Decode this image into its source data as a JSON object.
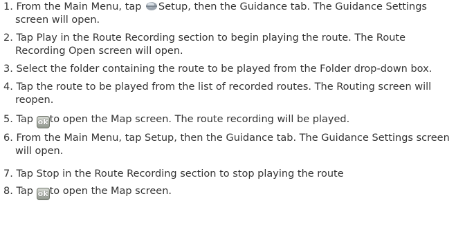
{
  "steps": [
    {
      "num": "1.",
      "before": "From the Main Menu, tap",
      "after": "Setup, then the Guidance tab. The Guidance Settings",
      "line2": "screen will open."
    },
    {
      "num": "2.",
      "line1": "Tap Play in the Route Recording section to begin playing the route. The Route",
      "line2": "Recording Open screen will open."
    },
    {
      "num": "3.",
      "line1": "Select the folder containing the route to be played from the Folder drop-down box."
    },
    {
      "num": "4.",
      "line1": "Tap the route to be played from the list of recorded routes. The Routing screen will",
      "line2": "reopen."
    },
    {
      "num": "5.",
      "before": "Tap",
      "after": "to open the Map screen. The route recording will be played."
    },
    {
      "num": "6.",
      "line1": "From the Main Menu, tap Setup, then the Guidance tab. The Guidance Settings screen",
      "line2": "will open."
    },
    {
      "num": "7.",
      "line1": "Tap Stop in the Route Recording section to stop playing the route"
    },
    {
      "num": "8.",
      "before": "Tap",
      "after": "to open the Map screen."
    }
  ],
  "icons": {
    "ok_label": "ok"
  }
}
